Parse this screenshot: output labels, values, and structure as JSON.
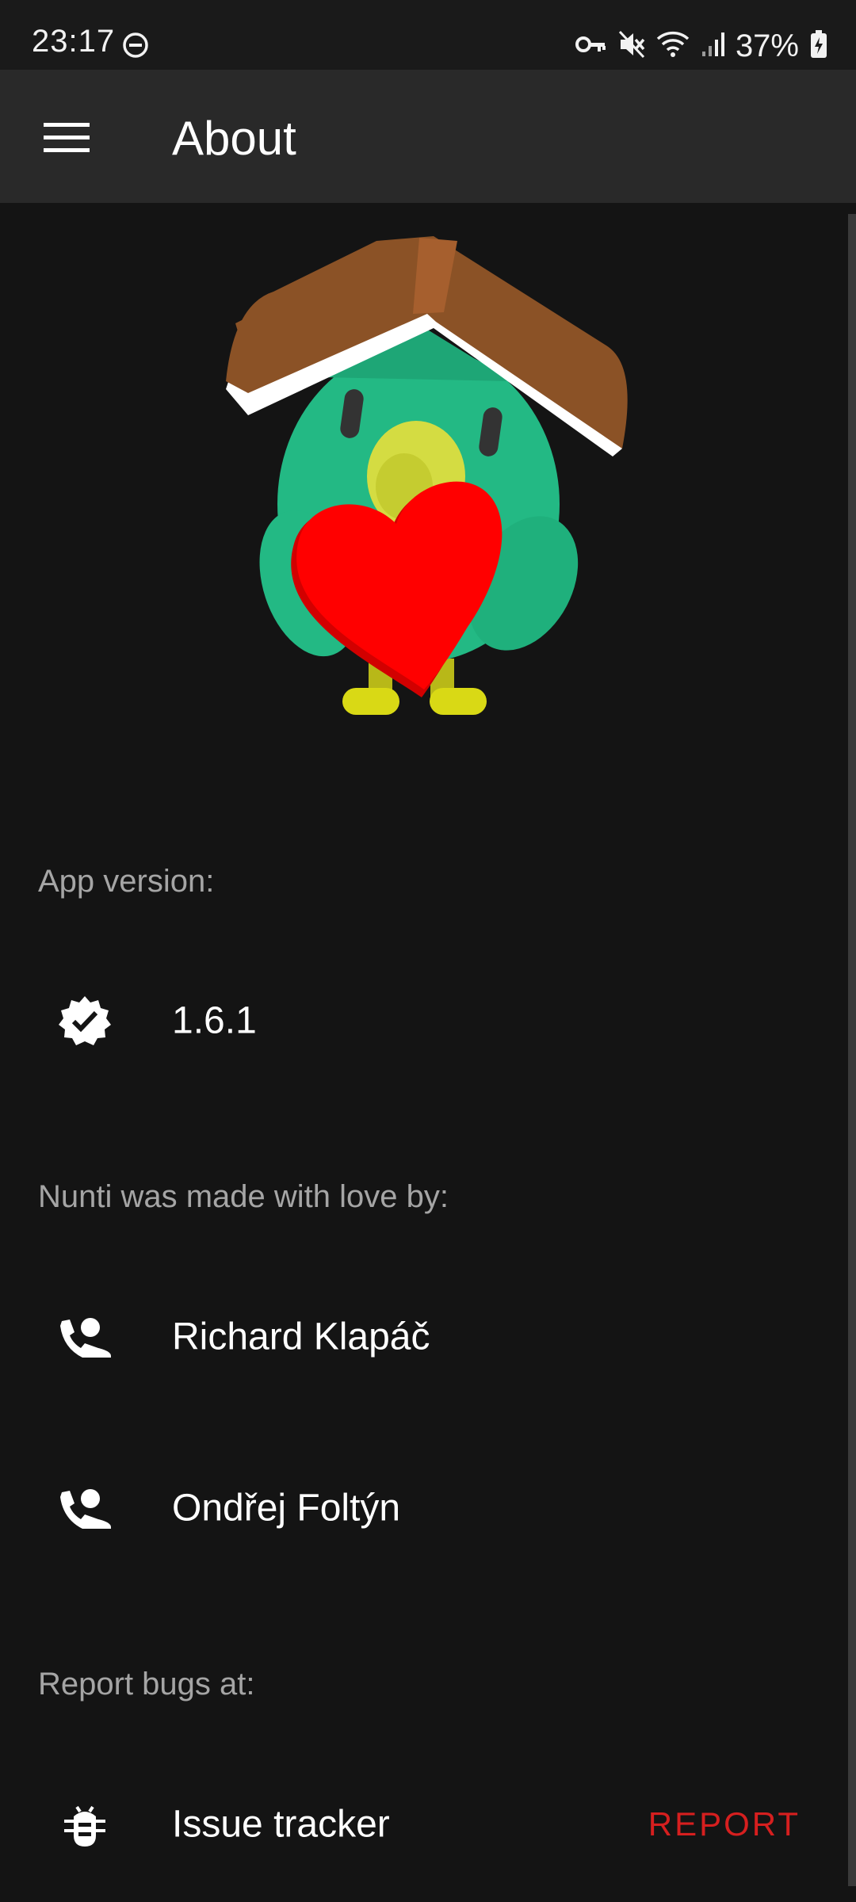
{
  "status_bar": {
    "time": "23:17",
    "battery_percent": "37%",
    "icons": [
      "do-not-disturb-icon",
      "vpn-key-icon",
      "mute-icon",
      "wifi-icon",
      "signal-icon",
      "battery-charging-icon"
    ]
  },
  "app_bar": {
    "title": "About",
    "menu_icon": "hamburger-menu-icon"
  },
  "colors": {
    "background": "#141414",
    "app_bar": "#292929",
    "accent_red": "#d61f1f",
    "secondary_text": "#a5a5a5"
  },
  "sections": {
    "version_header": "App version:",
    "version": "1.6.1",
    "authors_header": "Nunti was made with love by:",
    "authors": [
      "Richard Klapáč",
      "Ondřej Foltýn"
    ],
    "bugs_header": "Report bugs at:",
    "issue_tracker": "Issue tracker",
    "report_button": "REPORT"
  }
}
